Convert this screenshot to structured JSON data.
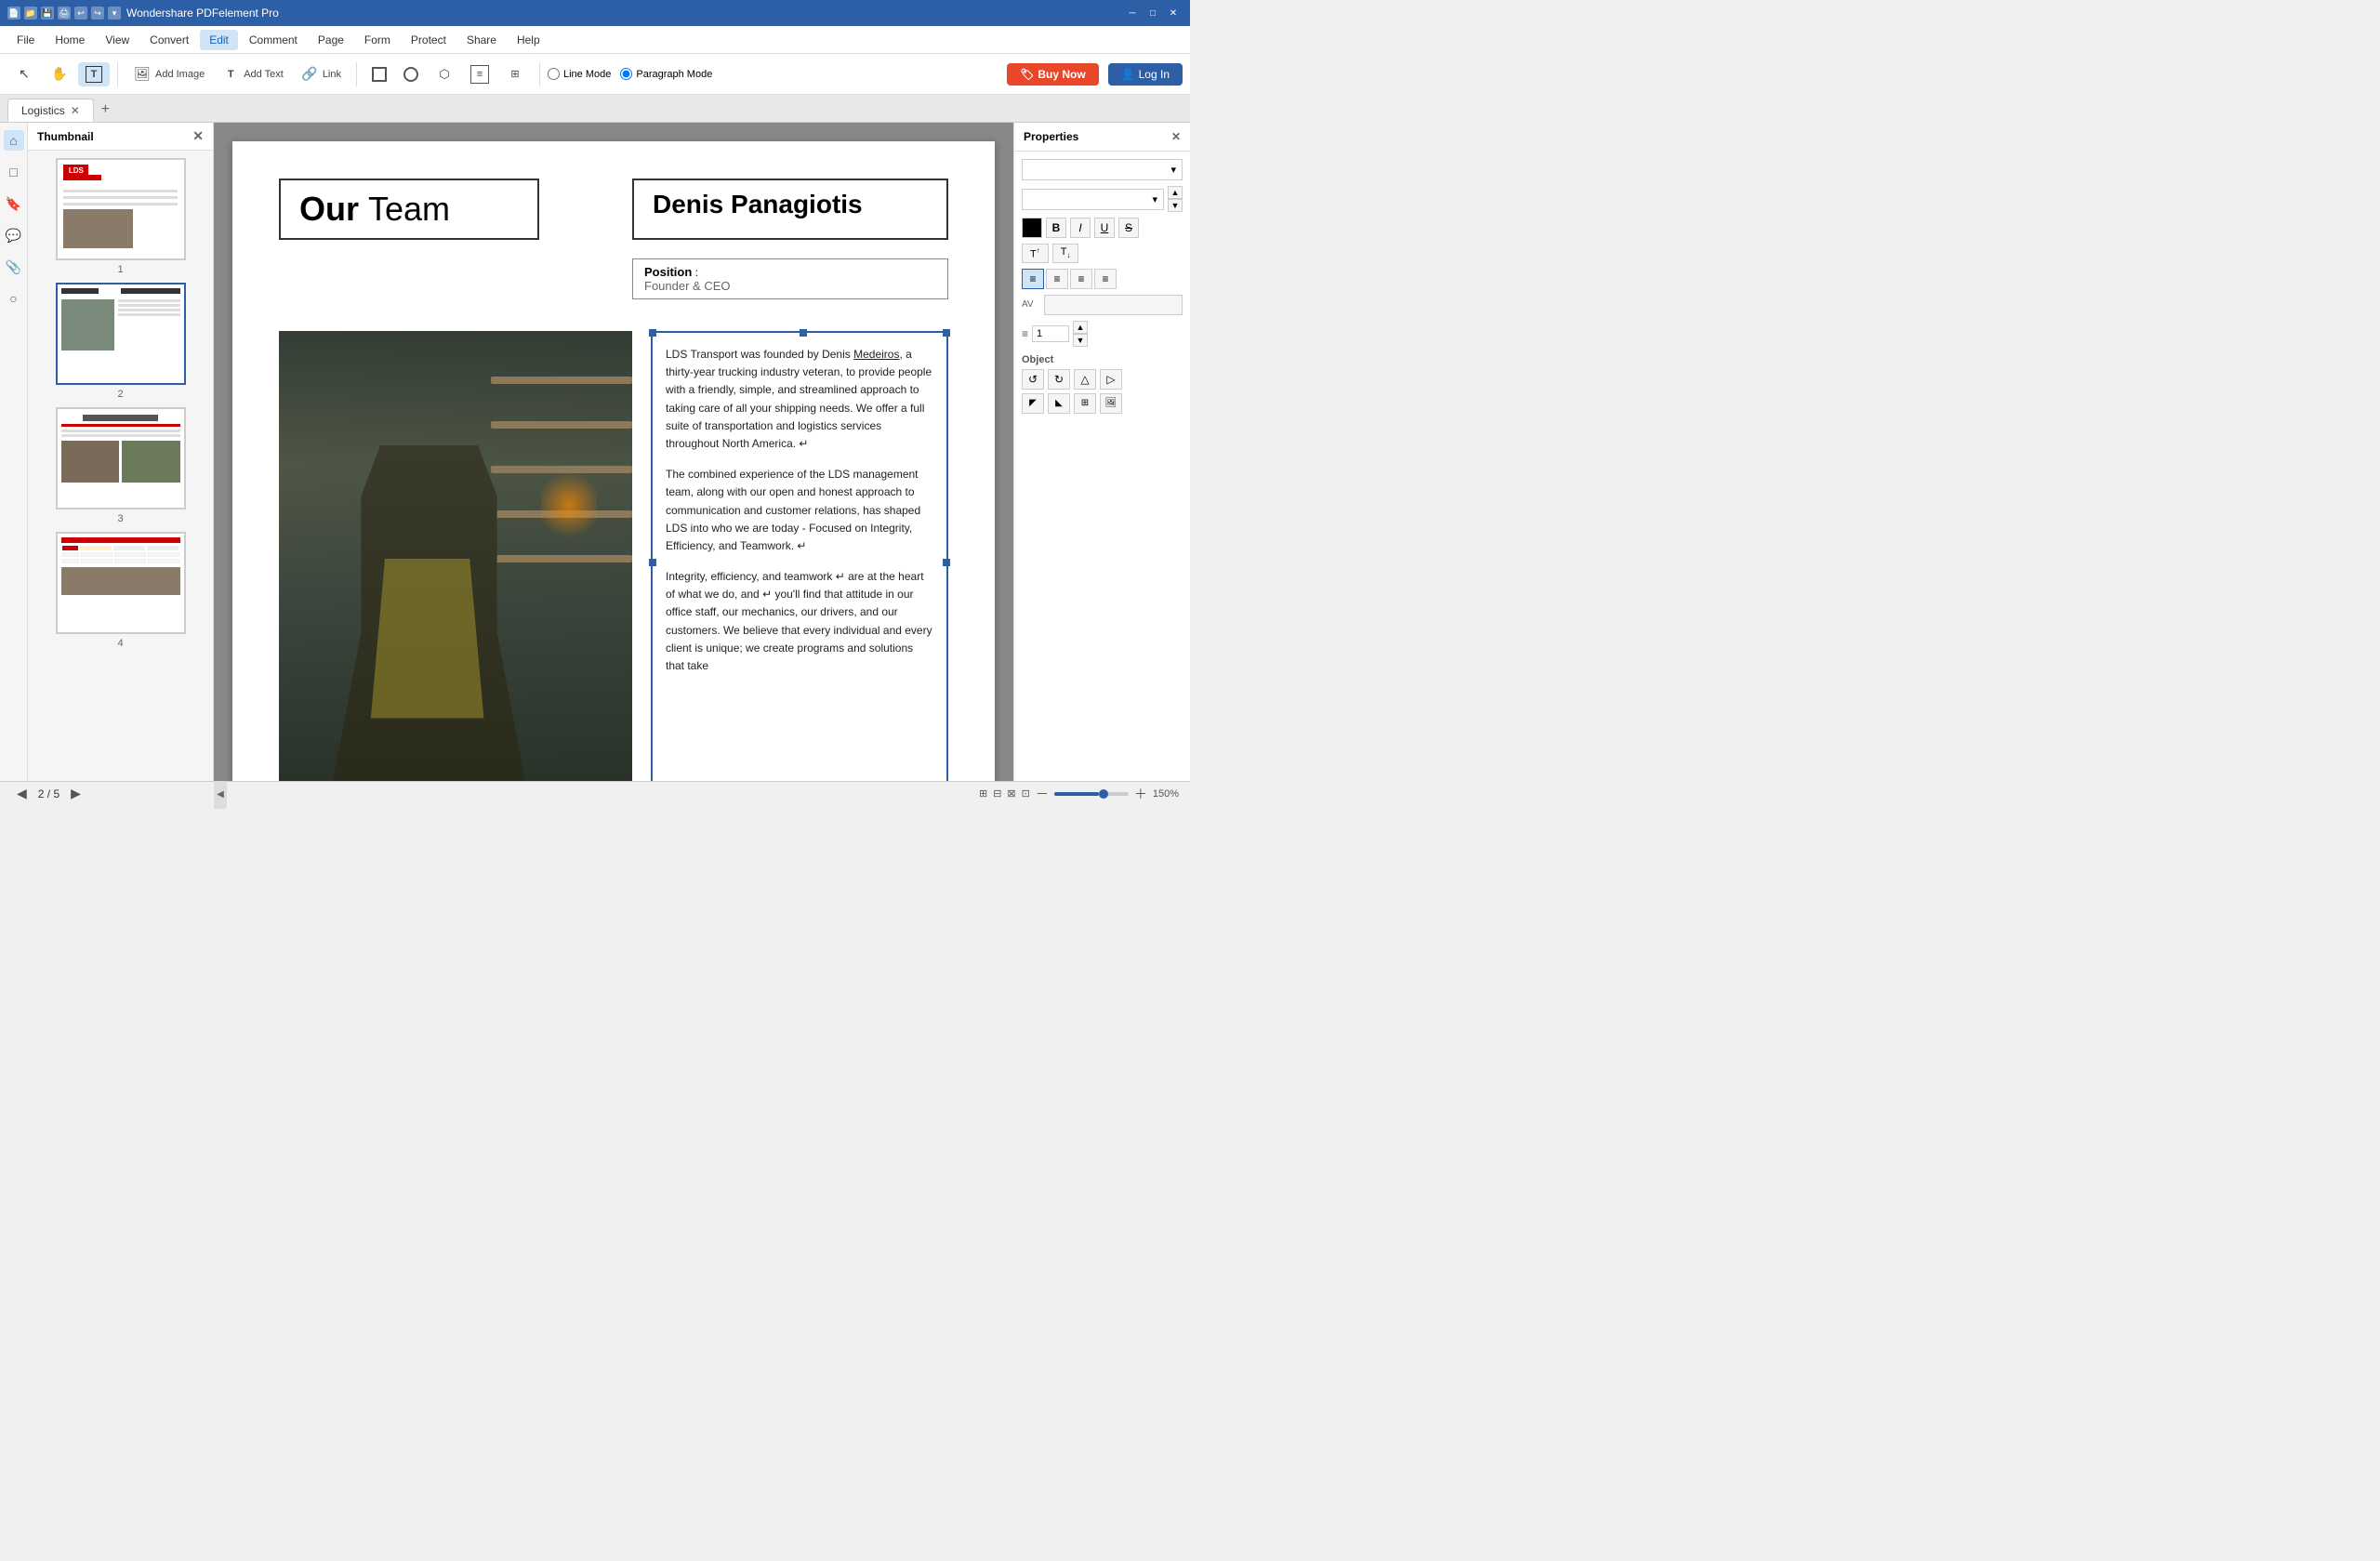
{
  "titleBar": {
    "title": "Wondershare PDFelement Pro",
    "icons": [
      "file",
      "folder",
      "save",
      "print",
      "undo",
      "redo",
      "arrow-down"
    ],
    "controls": [
      "minimize",
      "maximize",
      "close"
    ]
  },
  "menuBar": {
    "items": [
      "File",
      "Home",
      "View",
      "Convert",
      "Edit",
      "Comment",
      "Page",
      "Form",
      "Protect",
      "Share",
      "Help"
    ],
    "activeItem": "Edit"
  },
  "toolbar": {
    "tools": [
      {
        "name": "select",
        "icon": "↖",
        "label": ""
      },
      {
        "name": "hand",
        "icon": "✋",
        "label": ""
      },
      {
        "name": "edit-text",
        "icon": "T",
        "label": ""
      }
    ],
    "buttons": [
      {
        "name": "add-image",
        "label": "Add Image",
        "icon": "🖼"
      },
      {
        "name": "add-text",
        "label": "Add Text",
        "icon": "T"
      },
      {
        "name": "link",
        "label": "Link",
        "icon": "🔗"
      }
    ],
    "modeButtons": [
      {
        "name": "line-mode",
        "label": "Line Mode",
        "checked": false
      },
      {
        "name": "paragraph-mode",
        "label": "Paragraph Mode",
        "checked": true
      }
    ],
    "buyNow": "Buy Now",
    "logIn": "Log In"
  },
  "tabs": {
    "items": [
      {
        "label": "Logistics",
        "active": true
      },
      {
        "label": "+",
        "isAdd": true
      }
    ]
  },
  "thumbnailPanel": {
    "title": "Thumbnail",
    "pages": [
      {
        "number": "1",
        "active": false
      },
      {
        "number": "2",
        "active": true
      },
      {
        "number": "3",
        "active": false
      },
      {
        "number": "4",
        "active": false
      }
    ]
  },
  "page": {
    "ourTeam": "Our Team",
    "ourTeamBold": "Our",
    "ourTeamNormal": "Team",
    "personName": "Denis Panagiotis",
    "positionLabel": "Position",
    "positionValue": "Founder & CEO",
    "paragraphs": [
      "LDS Transport was founded by Denis Medeiros, a thirty-year trucking industry veteran, to provide people with a friendly, simple, and streamlined approach to taking care of all your shipping needs. We offer a full suite of transportation and logistics services throughout North America. ↵",
      "The combined experience of the LDS management team, along with our open and honest approach to communication and customer relations, has shaped LDS into who we are today - Focused on Integrity, Efficiency, and Teamwork. ↵",
      "Integrity, efficiency, and teamwork ↵ are at the heart of what we do, and ↵ you'll find that attitude in our office staff, our mechanics, our drivers, and our customers. We believe that every individual and every client is unique; we create programs and solutions that take"
    ]
  },
  "bottomBar": {
    "prevArrow": "◀",
    "nextArrow": "▶",
    "pageInfo": "2 / 5",
    "zoomLevel": "150%",
    "gridIcons": [
      "grid1",
      "grid2",
      "grid3",
      "grid4"
    ]
  },
  "properties": {
    "title": "Properties",
    "fontDropdown": "",
    "fontSize": "",
    "formatButtons": [
      "B",
      "I",
      "U",
      "S"
    ],
    "superscriptButtons": [
      "T↑",
      "T↓"
    ],
    "alignButtons": [
      "left",
      "center",
      "right",
      "justify"
    ],
    "colorLabel": "AV",
    "lineLabel": "≡",
    "lineValue": "1",
    "objectTitle": "Object",
    "objectButtons": [
      "↺",
      "↻",
      "△",
      "▷",
      "⌗",
      "⌗",
      "□",
      "🖼"
    ]
  }
}
